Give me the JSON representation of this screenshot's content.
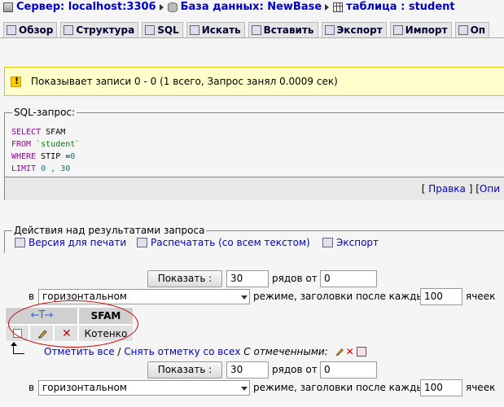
{
  "breadcrumb": {
    "server": "Сервер: localhost:3306",
    "database": "База данных: NewBase",
    "table": "таблица : student"
  },
  "tabs": [
    {
      "label": "Обзор",
      "icon": "browse-icon"
    },
    {
      "label": "Структура",
      "icon": "structure-icon"
    },
    {
      "label": "SQL",
      "icon": "sql-icon"
    },
    {
      "label": "Искать",
      "icon": "search-icon"
    },
    {
      "label": "Вставить",
      "icon": "insert-icon"
    },
    {
      "label": "Экспорт",
      "icon": "export-icon"
    },
    {
      "label": "Импорт",
      "icon": "import-icon"
    },
    {
      "label": "Оп",
      "icon": "operations-icon"
    }
  ],
  "notice": {
    "message": "Показывает записи 0 - 0 (1 всего, Запрос занял 0.0009 сек)"
  },
  "sql": {
    "legend": "SQL-запрос:",
    "line1_kw": "SELECT",
    "line1_rest": " SFAM",
    "line2_kw": "FROM",
    "line2_str": "`student`",
    "line3_kw": "WHERE",
    "line3_rest": " STIP =",
    "line3_num": "0",
    "line4_kw": "LIMIT",
    "line4_num": "0 , 30",
    "edit_link": "Правка",
    "explain_link": "Опи",
    "bracket_open": "[",
    "bracket_close": "]",
    "sep": "] ["
  },
  "actions": {
    "legend": "Действия над результатами запроса",
    "print_version": "Версия для печати",
    "print_full": "Распечатать (со всем текстом)",
    "export": "Экспорт"
  },
  "nav_top": {
    "show_button": "Показать :",
    "rows_value": "30",
    "rows_from_label": "рядов от",
    "from_value": "0",
    "in_label": "в",
    "mode_selected": "горизонтальном",
    "mode_label": "режиме, заголовки после каждых",
    "repeat_value": "100",
    "cells_label": "ячеек"
  },
  "nav_bottom": {
    "show_button": "Показать :",
    "rows_value": "30",
    "rows_from_label": "рядов от",
    "from_value": "0",
    "in_label": "в",
    "mode_selected": "горизонтальном",
    "mode_label": "режиме, заголовки после каждых",
    "repeat_value": "100",
    "cells_label": "ячеек"
  },
  "results": {
    "arrows": "←T→",
    "column_header": "SFAM",
    "rows": [
      {
        "SFAM": "Котенко"
      }
    ]
  },
  "check_row": {
    "check_all": "Отметить все",
    "slash": "/",
    "uncheck_all": "Снять отметку со всех",
    "with_selected": "С отмеченными:"
  },
  "colors": {
    "link": "#0000cc",
    "notice_bg": "#ffffcc",
    "annotation_ellipse": "#d00000",
    "delete_red": "#d40000"
  }
}
